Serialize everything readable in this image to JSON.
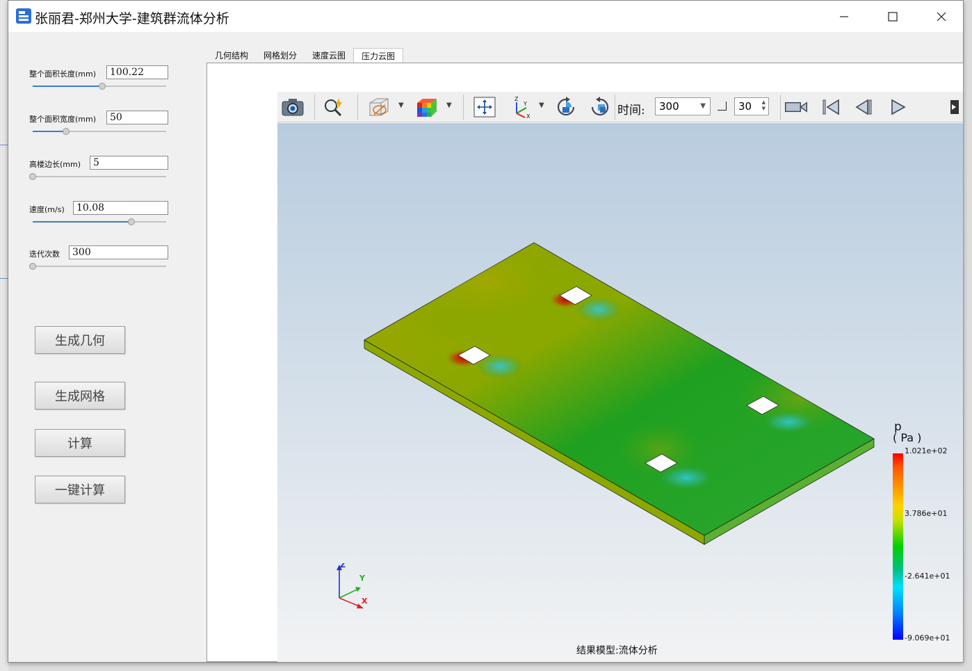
{
  "window": {
    "title": "张丽君-郑州大学-建筑群流体分析",
    "min_icon": "minimize-icon",
    "max_icon": "maximize-icon",
    "close_icon": "close-icon"
  },
  "params": [
    {
      "label": "整个面积长度(mm)",
      "value": "100.22",
      "slider_fraction": 0.52
    },
    {
      "label": "整个面积宽度(mm)",
      "value": "50",
      "slider_fraction": 0.25
    },
    {
      "label": "高楼边长(mm)",
      "value": "5",
      "slider_fraction": 0.0
    },
    {
      "label": "速度(m/s)",
      "value": "10.08",
      "slider_fraction": 0.74
    },
    {
      "label": "迭代次数",
      "value": "300",
      "slider_fraction": 0.0
    }
  ],
  "actions": {
    "gen_geometry": "生成几何",
    "gen_mesh": "生成网格",
    "compute": "计算",
    "one_click": "一键计算"
  },
  "tabs": [
    "几何结构",
    "网格划分",
    "速度云图",
    "压力云图"
  ],
  "active_tab": 3,
  "toolbar": {
    "icons": [
      "camera-icon",
      "zoom-magic-icon",
      "wireframe-box-icon",
      "color-cube-icon",
      "fit-view-icon",
      "axes-icon",
      "rotate-cw-icon",
      "rotate-ccw-icon",
      "video-record-icon",
      "skip-first-icon",
      "step-back-icon",
      "play-icon",
      "more-icon"
    ],
    "time_label": "时间:",
    "time_value": "300",
    "step_value": "30"
  },
  "viewport": {
    "result_label": "结果模型:流体分析",
    "legend": {
      "title": "p",
      "unit": "( Pa )",
      "max": "1.021e+02",
      "mid_high": "3.786e+01",
      "mid_low": "-2.641e+01",
      "min": "-9.069e+01",
      "colors": [
        "#ff0000",
        "#ffd200",
        "#00d000",
        "#00e0ff",
        "#0000ff"
      ]
    },
    "axes": {
      "x": "X",
      "y": "Y",
      "z": "Z"
    }
  }
}
